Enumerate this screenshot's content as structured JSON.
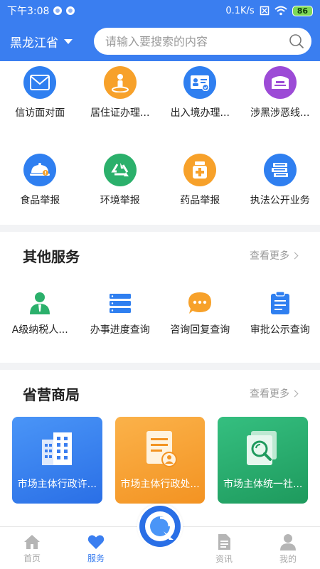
{
  "status_bar": {
    "time": "下午3:08",
    "network": "0.1K/s",
    "battery": "86"
  },
  "header": {
    "region": "黑龙江省",
    "search_placeholder": "请输入要搜索的内容"
  },
  "services_top": [
    {
      "label": "信访面对面",
      "icon": "envelope-icon",
      "color": "#2f7ff0"
    },
    {
      "label": "居住证办理...",
      "icon": "person-location-icon",
      "color": "#f7a12a"
    },
    {
      "label": "出入境办理...",
      "icon": "id-card-icon",
      "color": "#2f7ff0"
    },
    {
      "label": "涉黑涉恶线...",
      "icon": "mailbox-icon",
      "color": "#9c4bd6"
    },
    {
      "label": "食品举报",
      "icon": "food-cloche-icon",
      "color": "#2f7ff0"
    },
    {
      "label": "环境举报",
      "icon": "recycle-icon",
      "color": "#2bb06b"
    },
    {
      "label": "药品举报",
      "icon": "medicine-icon",
      "color": "#f7a12a"
    },
    {
      "label": "执法公开业务",
      "icon": "books-icon",
      "color": "#2f7ff0"
    }
  ],
  "other_services": {
    "title": "其他服务",
    "more": "查看更多",
    "items": [
      {
        "label": "A级纳税人...",
        "icon": "tax-person-icon",
        "color": "#2bb06b"
      },
      {
        "label": "办事进度查询",
        "icon": "progress-list-icon",
        "color": "#2f7ff0"
      },
      {
        "label": "咨询回复查询",
        "icon": "chat-bubble-icon",
        "color": "#f7a12a"
      },
      {
        "label": "审批公示查询",
        "icon": "clipboard-icon",
        "color": "#2f7ff0"
      }
    ]
  },
  "provincial": {
    "title": "省营商局",
    "more": "查看更多",
    "tiles": [
      {
        "label": "市场主体行政许...",
        "icon": "buildings-icon",
        "color": "#2f7ff0"
      },
      {
        "label": "市场主体行政处...",
        "icon": "document-person-icon",
        "color": "#f7a12a"
      },
      {
        "label": "市场主体统一社...",
        "icon": "magnify-document-icon",
        "color": "#27a86a"
      }
    ]
  },
  "tabbar": {
    "items": [
      {
        "label": "首页",
        "icon": "home-icon"
      },
      {
        "label": "服务",
        "icon": "heart-icon"
      },
      {
        "label": "资讯",
        "icon": "news-icon"
      },
      {
        "label": "我的",
        "icon": "profile-icon"
      }
    ],
    "active_color": "#3a7ef0"
  }
}
